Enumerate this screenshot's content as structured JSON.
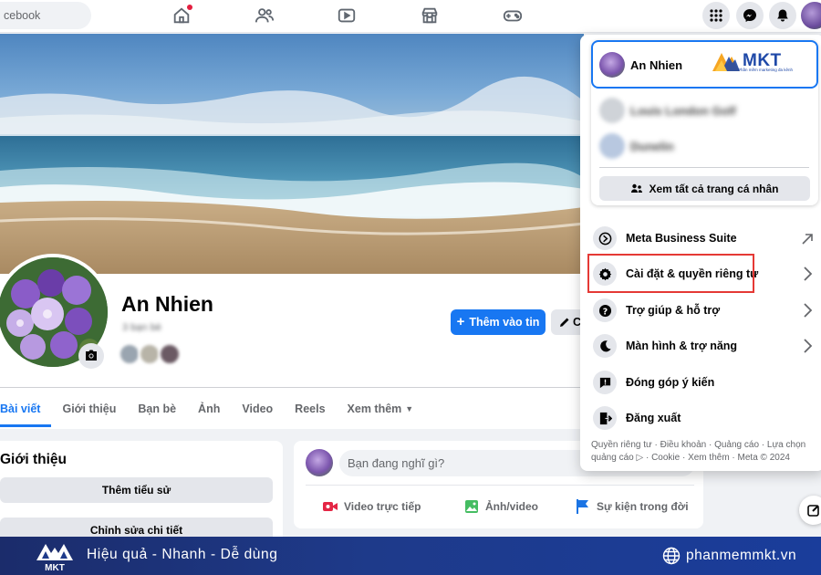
{
  "nav": {
    "search_text": "cebook",
    "icons": [
      "home-icon",
      "friends-icon",
      "video-icon",
      "marketplace-icon",
      "gaming-icon",
      "menu-grid-icon",
      "messenger-icon",
      "notifications-icon"
    ]
  },
  "profile": {
    "name": "An Nhien",
    "friends_count": "3 bạn bè",
    "add_story_label": "Thêm vào tin",
    "edit_label": "C"
  },
  "tabs": [
    {
      "label": "Bài viết",
      "active": true
    },
    {
      "label": "Giới thiệu"
    },
    {
      "label": "Bạn bè"
    },
    {
      "label": "Ảnh"
    },
    {
      "label": "Video"
    },
    {
      "label": "Reels"
    },
    {
      "label": "Xem thêm"
    }
  ],
  "intro": {
    "title": "Giới thiệu",
    "add_bio": "Thêm tiểu sử",
    "edit_details": "Chỉnh sửa chi tiết"
  },
  "composer": {
    "placeholder": "Bạn đang nghĩ gì?",
    "actions": [
      "Video trực tiếp",
      "Ảnh/video",
      "Sự kiện trong đời"
    ]
  },
  "menu": {
    "accounts": [
      {
        "name": "An Nhien",
        "active": true
      },
      {
        "name": "Louis London Golf",
        "blurred": true
      },
      {
        "name": "Dunelin",
        "blurred": true
      }
    ],
    "see_all_profiles": "Xem tất cả trang cá nhân",
    "items": [
      {
        "label": "Meta Business Suite",
        "icon": "meta-business-icon",
        "right": "external-arrow-icon"
      },
      {
        "label": "Cài đặt & quyền riêng tư",
        "icon": "gear-icon",
        "right": "chevron-right-icon",
        "highlighted": true
      },
      {
        "label": "Trợ giúp & hỗ trợ",
        "icon": "help-icon",
        "right": "chevron-right-icon"
      },
      {
        "label": "Màn hình & trợ năng",
        "icon": "moon-icon",
        "right": "chevron-right-icon"
      },
      {
        "label": "Đóng góp ý kiến",
        "icon": "feedback-icon"
      },
      {
        "label": "Đăng xuất",
        "icon": "logout-icon"
      }
    ],
    "footer_line1": "Quyền riêng tư · Điều khoản · Quảng cáo · Lựa chọn",
    "footer_line2": "quảng cáo ▷ · Cookie · Xem thêm · Meta © 2024",
    "highlight_color": "#e53935"
  },
  "watermark": {
    "brand": "MKT",
    "tagline": "Phần mềm marketing đa kênh"
  },
  "banner": {
    "slogan": "Hiệu quả - Nhanh - Dễ dùng",
    "website": "phanmemmkt.vn",
    "brand": "MKT"
  },
  "colors": {
    "accent": "#1877f2",
    "banner": "#1e3a8a"
  }
}
